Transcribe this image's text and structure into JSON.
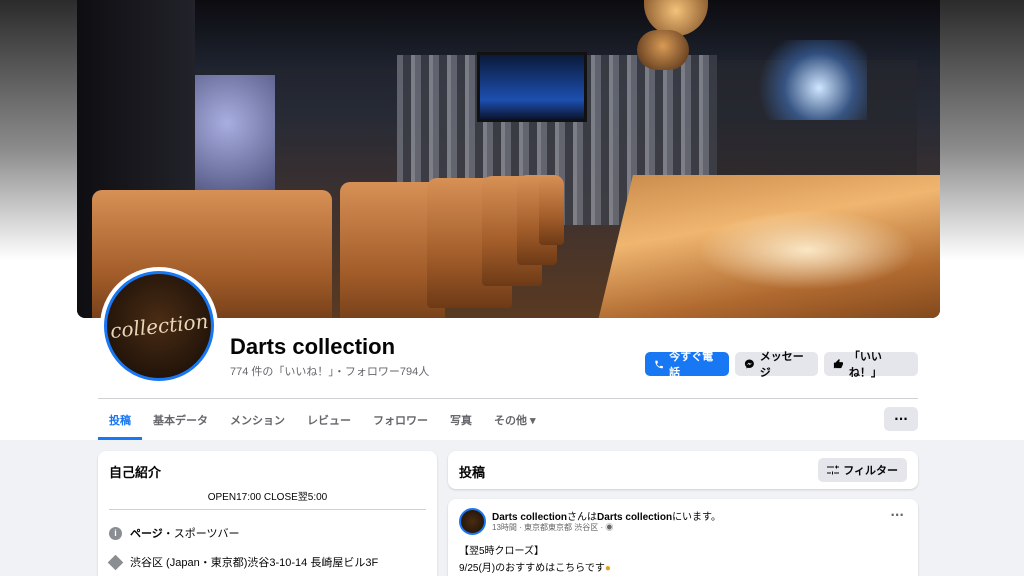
{
  "page": {
    "name": "Darts collection",
    "stats": "774 件の「いいね！」・フォロワー794人",
    "avatar_text": "collection"
  },
  "actions": {
    "call": "今すぐ電話",
    "message": "メッセージ",
    "like": "「いいね！」"
  },
  "tabs": [
    {
      "label": "投稿",
      "active": true
    },
    {
      "label": "基本データ"
    },
    {
      "label": "メンション"
    },
    {
      "label": "レビュー"
    },
    {
      "label": "フォロワー"
    },
    {
      "label": "写真"
    },
    {
      "label": "その他 ▾"
    }
  ],
  "more_label": "···",
  "intro": {
    "title": "自己紹介",
    "hours": "OPEN17:00 CLOSE翌5:00",
    "category_label": "ページ",
    "category_value": "・スポーツバー",
    "address": "渋谷区 (Japan・東京都)渋谷3-10-14 長崎屋ビル3F"
  },
  "posts": {
    "title": "投稿",
    "filter_label": "フィルター",
    "item": {
      "author": "Darts collection",
      "author_suffix": "さんは",
      "location": "Darts collection",
      "location_suffix": "にいます。",
      "meta": "13時間 · 東京都東京都 渋谷区 · ",
      "line1": "【翌5時クローズ】",
      "line2": "9/25(月)のおすすめはこちらです"
    }
  },
  "colors": {
    "accent": "#1877f2",
    "background": "#f0f2f5",
    "secondary_text": "#65676b"
  }
}
